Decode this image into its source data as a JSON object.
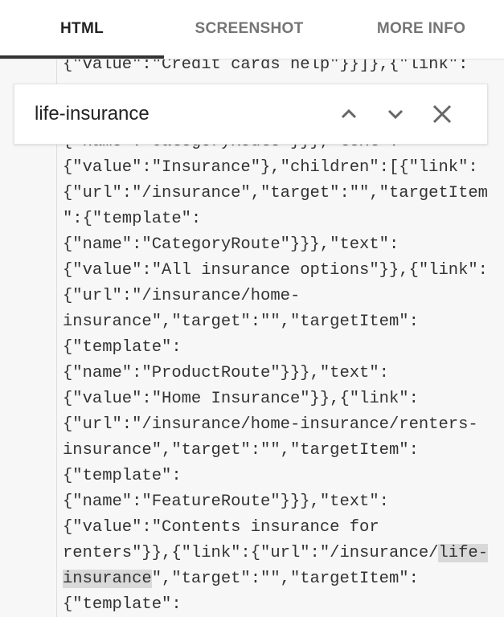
{
  "tabs": [
    {
      "label": "HTML",
      "active": true
    },
    {
      "label": "SCREENSHOT",
      "active": false
    },
    {
      "label": "MORE INFO",
      "active": false
    }
  ],
  "search": {
    "value": "life-insurance",
    "prev_icon": "chevron-up-icon",
    "next_icon": "chevron-down-icon",
    "close_icon": "close-icon"
  },
  "code": {
    "lines": [
      "{\"value\":\"Credit cards help\"}}]},{\"link\":",
      "{\"name\":\"CategoryRoute\"}}},\"text\":",
      "{\"value\":\"Insurance\"},\"children\":[{\"link\":",
      "{\"url\":\"/insurance\",\"target\":\"\",\"targetItem",
      "\":{\"template\":",
      "{\"name\":\"CategoryRoute\"}}},\"text\":",
      "{\"value\":\"All insurance options\"}},{\"link\":",
      "{\"url\":\"/insurance/home-",
      "insurance\",\"target\":\"\",\"targetItem\":",
      "{\"template\":",
      "{\"name\":\"ProductRoute\"}}},\"text\":",
      "{\"value\":\"Home Insurance\"}},{\"link\":",
      "{\"url\":\"/insurance/home-insurance/renters-",
      "insurance\",\"target\":\"\",\"targetItem\":",
      "{\"template\":",
      "{\"name\":\"FeatureRoute\"}}},\"text\":",
      "{\"value\":\"Contents insurance for"
    ],
    "match_line_1": {
      "before": "renters\"}},{\"link\":{\"url\":\"/insurance/",
      "match": "life-"
    },
    "match_line_2": {
      "match": "insurance",
      "after": "\",\"target\":\"\",\"targetItem\":"
    },
    "last_line": "{\"template\":"
  }
}
